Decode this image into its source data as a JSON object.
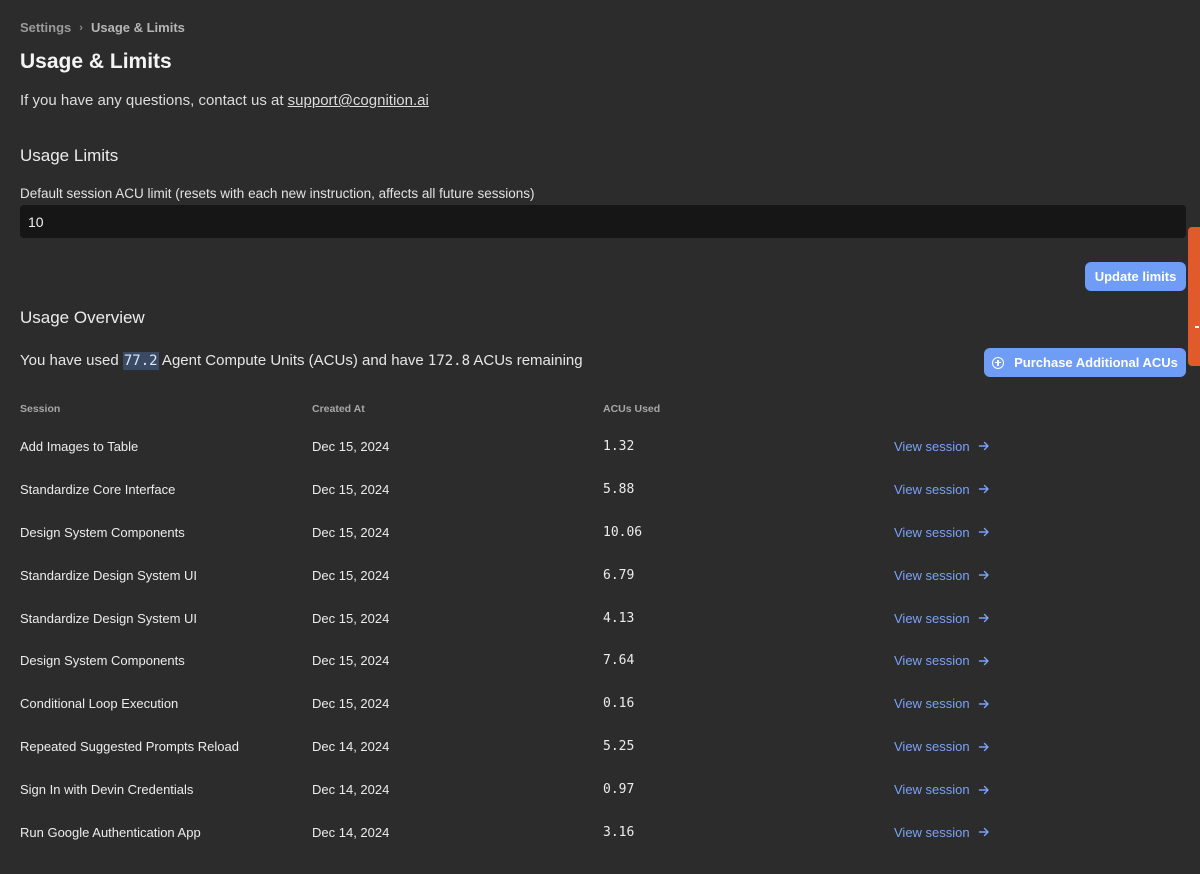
{
  "breadcrumb": {
    "parent": "Settings",
    "current": "Usage & Limits"
  },
  "page_title": "Usage & Limits",
  "contact": {
    "text": "If you have any questions, contact us at ",
    "email": "support@cognition.ai"
  },
  "usage_limits": {
    "title": "Usage Limits",
    "field_label": "Default session ACU limit (resets with each new instruction, affects all future sessions)",
    "field_value": "10",
    "update_button": "Update limits"
  },
  "usage_overview": {
    "title": "Usage Overview",
    "summary_prefix": "You have used ",
    "used": "77.2",
    "summary_middle": " Agent Compute Units (ACUs) and have ",
    "remaining": "172.8",
    "summary_suffix": " ACUs remaining",
    "purchase_button": "Purchase Additional ACUs"
  },
  "table": {
    "headers": [
      "Session",
      "Created At",
      "ACUs Used"
    ],
    "link_label": "View session",
    "rows": [
      {
        "session": "Add Images to Table",
        "created": "Dec 15, 2024",
        "acus": "1.32"
      },
      {
        "session": "Standardize Core Interface",
        "created": "Dec 15, 2024",
        "acus": "5.88"
      },
      {
        "session": "Design System Components",
        "created": "Dec 15, 2024",
        "acus": "10.06"
      },
      {
        "session": "Standardize Design System UI",
        "created": "Dec 15, 2024",
        "acus": "6.79"
      },
      {
        "session": "Standardize Design System UI",
        "created": "Dec 15, 2024",
        "acus": "4.13"
      },
      {
        "session": "Design System Components",
        "created": "Dec 15, 2024",
        "acus": "7.64"
      },
      {
        "session": "Conditional Loop Execution",
        "created": "Dec 15, 2024",
        "acus": "0.16"
      },
      {
        "session": "Repeated Suggested Prompts Reload",
        "created": "Dec 14, 2024",
        "acus": "5.25"
      },
      {
        "session": "Sign In with Devin Credentials",
        "created": "Dec 14, 2024",
        "acus": "0.97"
      },
      {
        "session": "Run Google Authentication App",
        "created": "Dec 14, 2024",
        "acus": "3.16"
      }
    ]
  },
  "icons": {
    "breadcrumb_separator": "chevron-right-icon",
    "purchase": "plus-circle-icon",
    "view_session": "arrow-right-icon"
  },
  "colors": {
    "background": "#2c2c2c",
    "accent": "#6f9cf5",
    "link": "#7aa2f7",
    "input_bg": "#161616",
    "side_tab": "#e05a2b"
  }
}
